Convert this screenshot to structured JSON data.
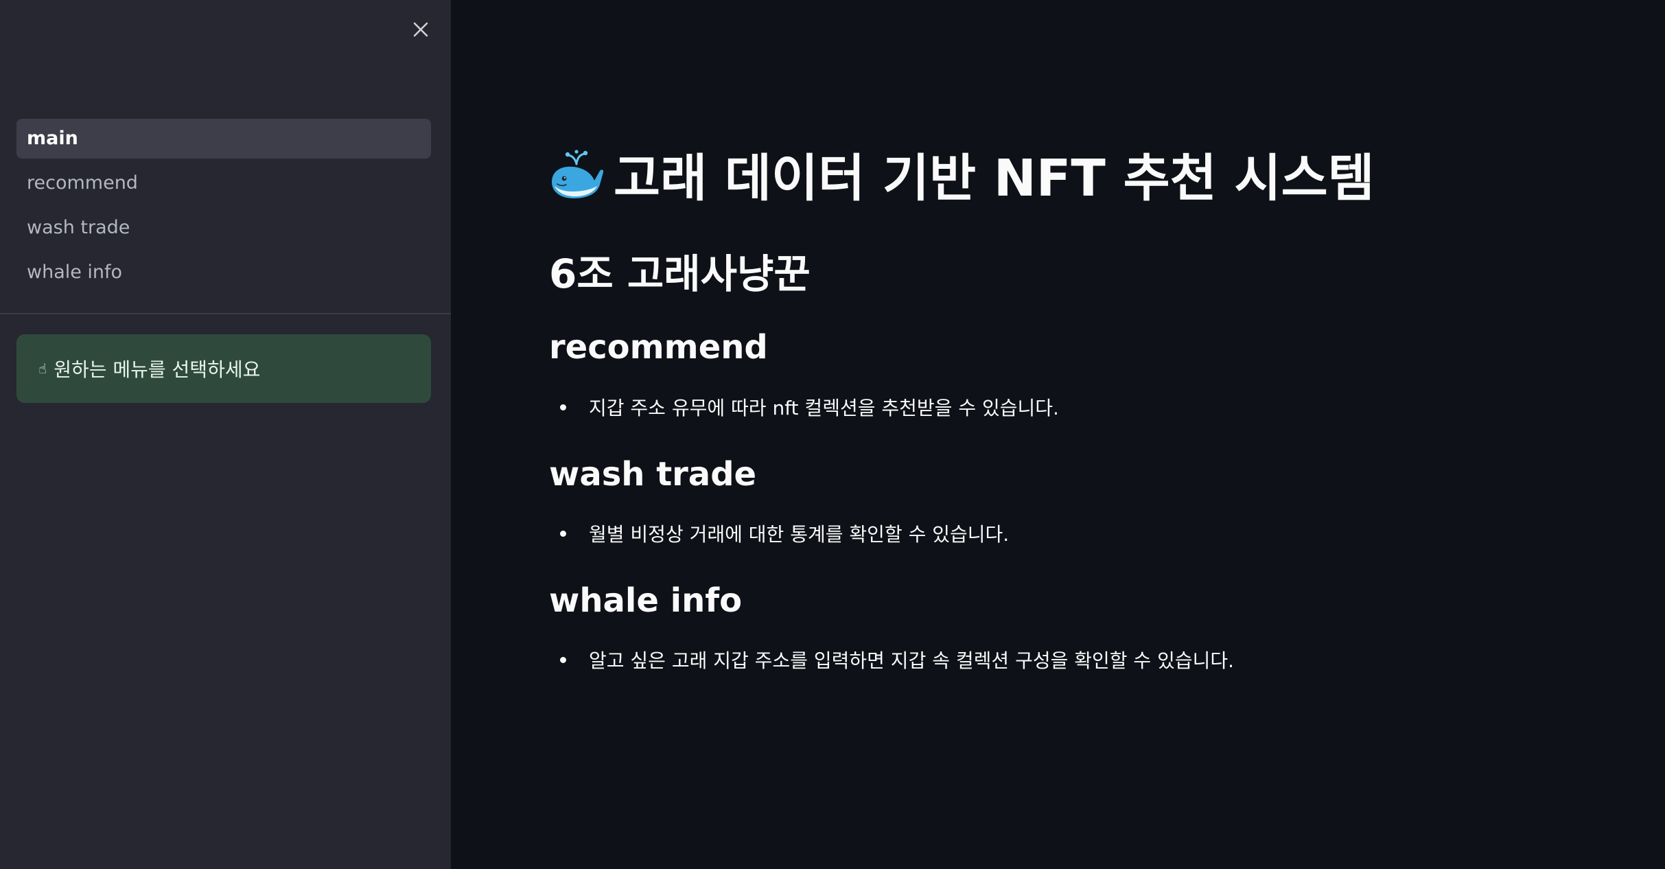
{
  "sidebar": {
    "close_icon": "close-icon",
    "nav_items": [
      {
        "label": "main",
        "active": true
      },
      {
        "label": "recommend",
        "active": false
      },
      {
        "label": "wash trade",
        "active": false
      },
      {
        "label": "whale info",
        "active": false
      }
    ],
    "info_box": {
      "icon": "pointing-hand-icon",
      "text": "원하는 메뉴를 선택하세요"
    }
  },
  "main": {
    "title_icon": "whale-icon",
    "title": "고래 데이터 기반 NFT 추천 시스템",
    "team_name": "6조 고래사냥꾼",
    "sections": [
      {
        "heading": "recommend",
        "bullet": "지갑 주소 유무에 따라 nft 컬렉션을 추천받을 수 있습니다."
      },
      {
        "heading": "wash trade",
        "bullet": "월별 비정상 거래에 대한 통계를 확인할 수 있습니다."
      },
      {
        "heading": "whale info",
        "bullet": "알고 싶은 고래 지갑 주소를 입력하면 지갑 속 컬렉션 구성을 확인할 수 있습니다."
      }
    ]
  },
  "colors": {
    "main_background": "#0e1117",
    "sidebar_background": "#262730",
    "active_nav_background": "#3d3e4a",
    "info_box_background": "#2f4a3c",
    "text_primary": "#fafafa",
    "text_muted": "#b4b7bf"
  }
}
